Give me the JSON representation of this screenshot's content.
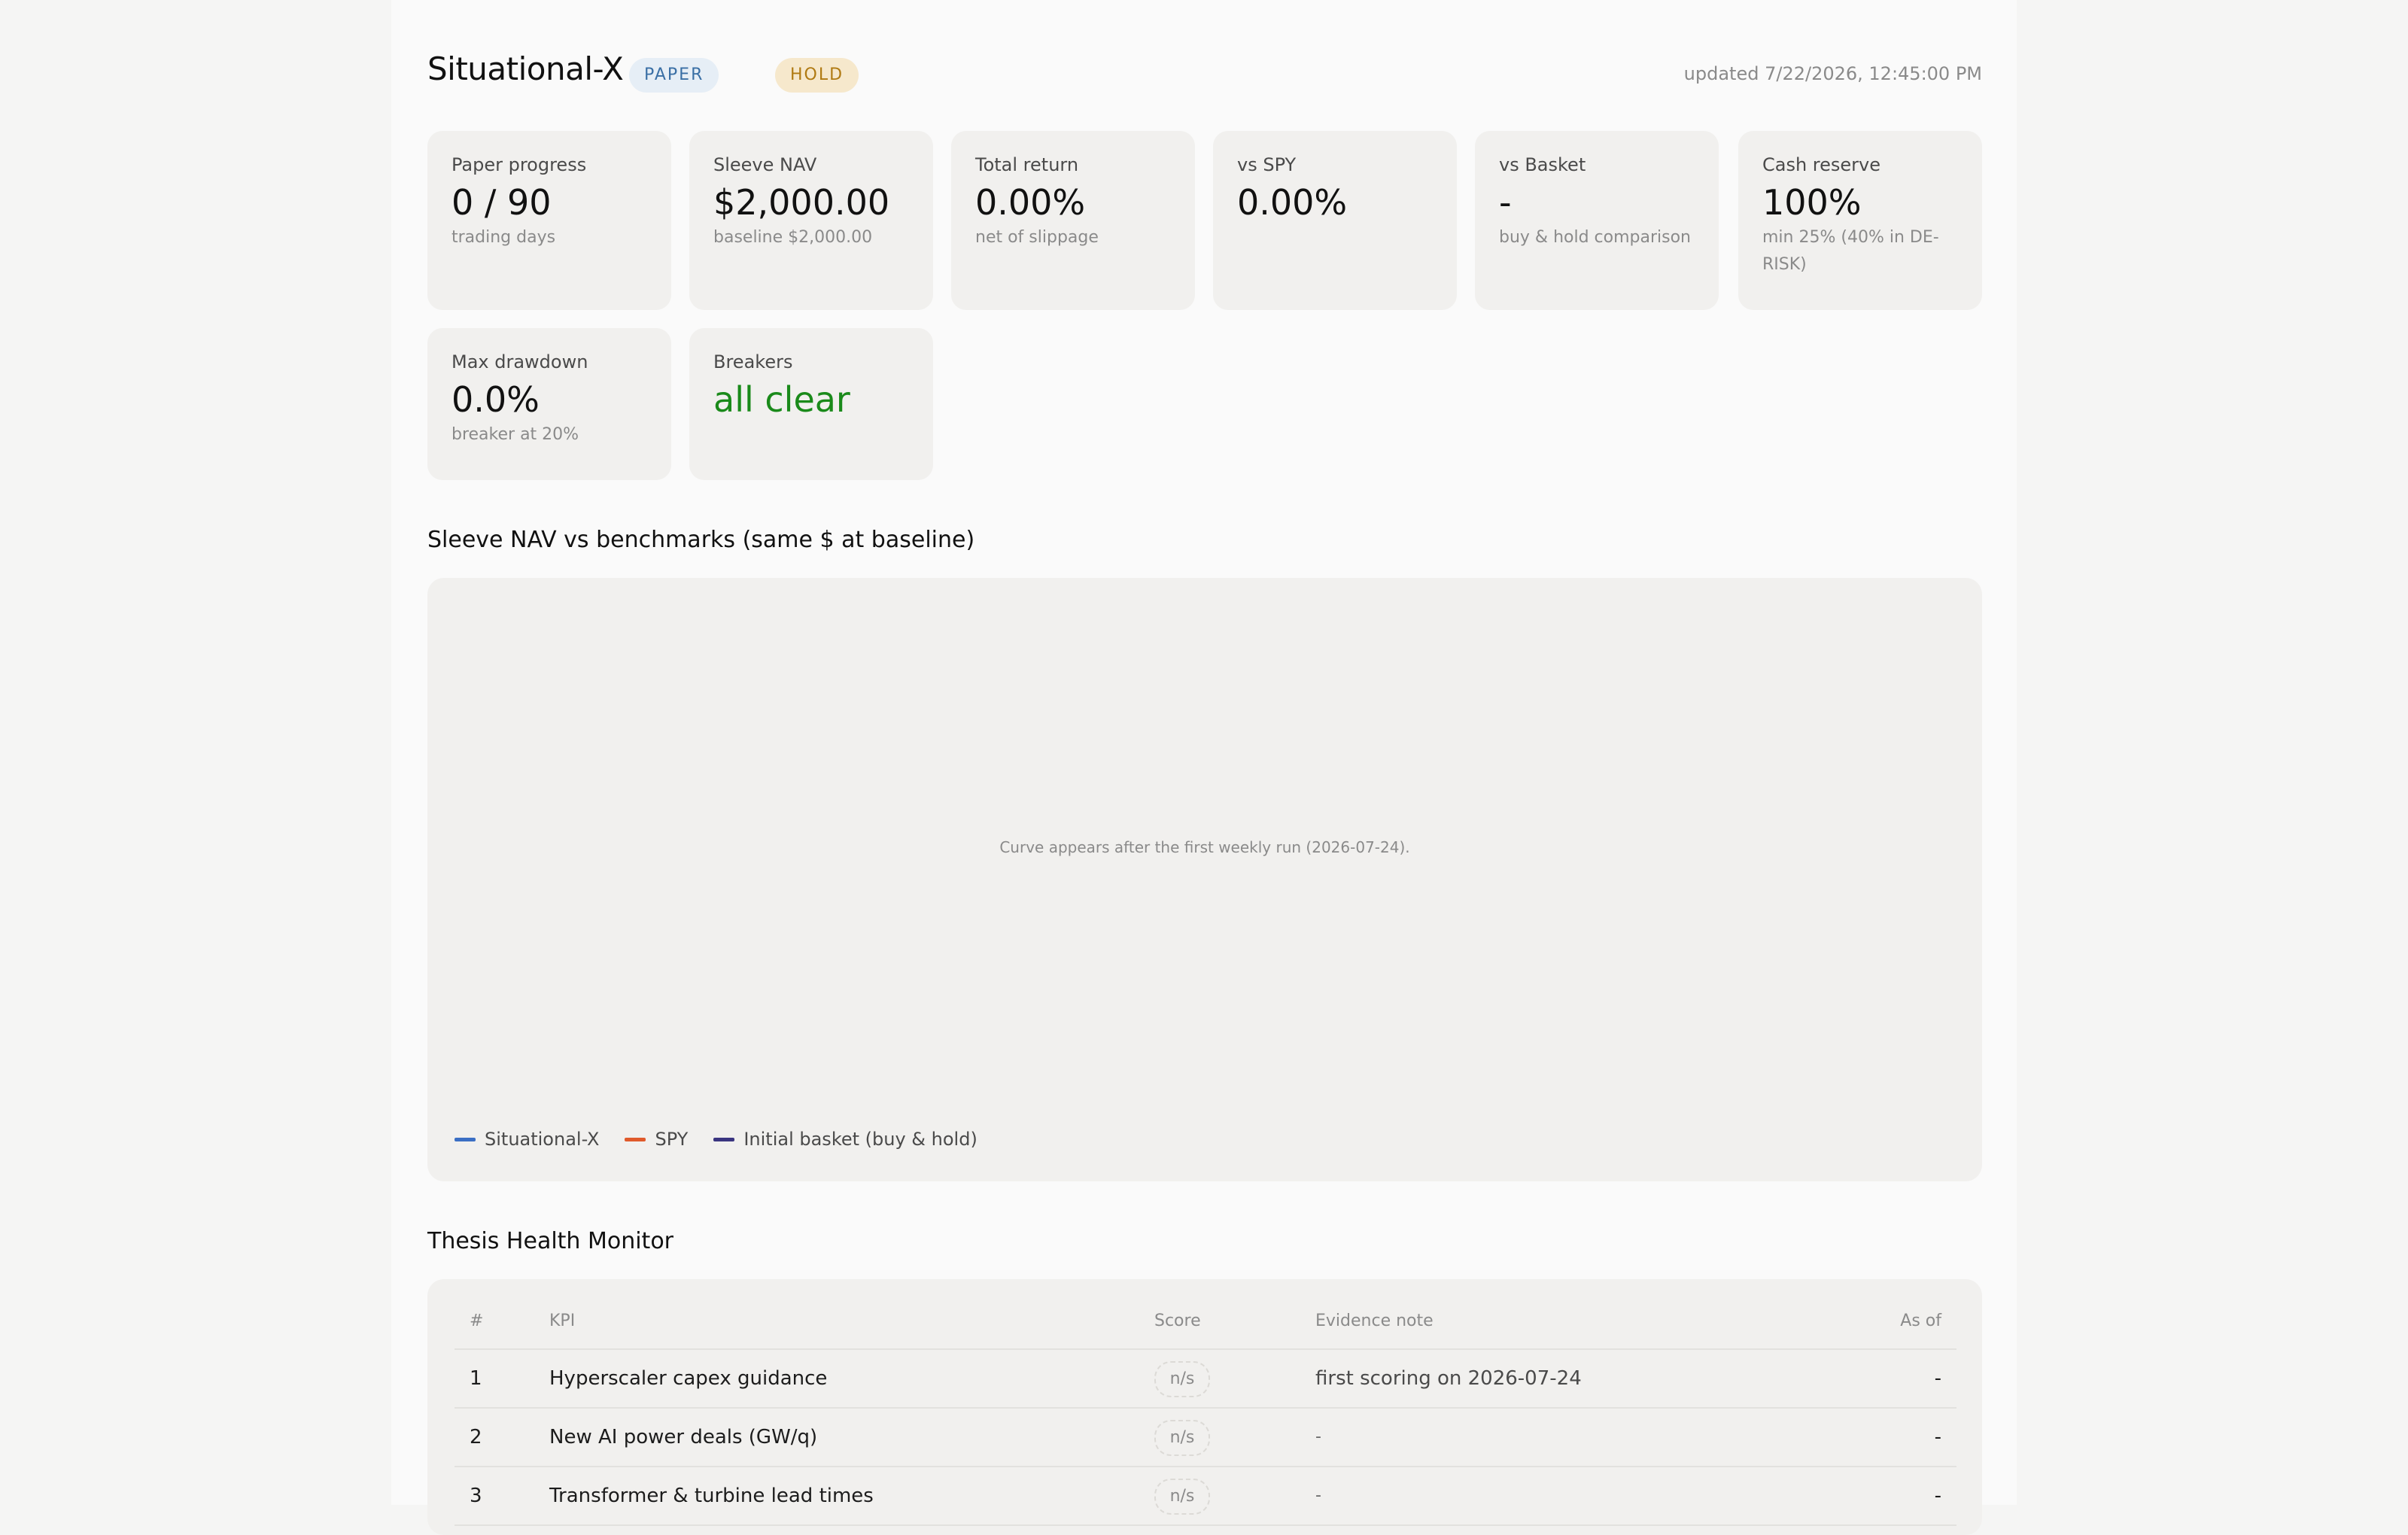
{
  "header": {
    "title": "Situational-X",
    "badges": [
      "PAPER",
      "HOLD"
    ],
    "updated": "updated 7/22/2026, 12:45:00 PM"
  },
  "stats": [
    {
      "label": "Paper progress",
      "value": "0 / 90",
      "sub": "trading days"
    },
    {
      "label": "Sleeve NAV",
      "value": "$2,000.00",
      "sub": "baseline $2,000.00"
    },
    {
      "label": "Total return",
      "value": "0.00%",
      "sub": "net of slippage"
    },
    {
      "label": "vs SPY",
      "value": "0.00%",
      "sub": ""
    },
    {
      "label": "vs Basket",
      "value": "-",
      "sub": "buy & hold comparison"
    },
    {
      "label": "Cash reserve",
      "value": "100%",
      "sub": "min 25% (40% in DE-RISK)"
    },
    {
      "label": "Max drawdown",
      "value": "0.0%",
      "sub": "breaker at 20%"
    },
    {
      "label": "Breakers",
      "value": "all clear",
      "sub": ""
    }
  ],
  "chart": {
    "title": "Sleeve NAV vs benchmarks (same $ at baseline)",
    "empty_message": "Curve appears after the first weekly run (2026-07-24).",
    "legend": [
      {
        "name": "Situational-X",
        "color": "#3b6fc4"
      },
      {
        "name": "SPY",
        "color": "#e05a2b"
      },
      {
        "name": "Initial basket (buy & hold)",
        "color": "#3a3580"
      }
    ]
  },
  "thesis": {
    "title": "Thesis Health Monitor",
    "columns": [
      "#",
      "KPI",
      "Score",
      "Evidence note",
      "As of"
    ],
    "rows": [
      {
        "num": "1",
        "kpi": "Hyperscaler capex guidance",
        "score": "n/s",
        "note": "first scoring on 2026-07-24",
        "asof": "-"
      },
      {
        "num": "2",
        "kpi": "New AI power deals (GW/q)",
        "score": "n/s",
        "note": "-",
        "asof": "-"
      },
      {
        "num": "3",
        "kpi": "Transformer & turbine lead times",
        "score": "n/s",
        "note": "-",
        "asof": "-"
      }
    ]
  }
}
